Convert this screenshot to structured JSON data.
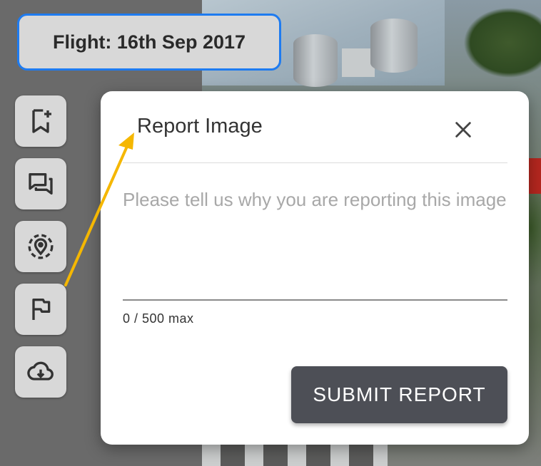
{
  "flight": {
    "label": "Flight: 16th Sep 2017"
  },
  "toolbar": {
    "items": [
      {
        "name": "bookmark-add",
        "icon": "bookmark-plus-icon"
      },
      {
        "name": "comments",
        "icon": "chat-icon"
      },
      {
        "name": "location",
        "icon": "location-pin-icon"
      },
      {
        "name": "report",
        "icon": "flag-icon"
      },
      {
        "name": "download",
        "icon": "cloud-download-icon"
      }
    ]
  },
  "dialog": {
    "title": "Report Image",
    "placeholder": "Please tell us why you are reporting this image",
    "counter": "0 / 500 max",
    "submit_label": "SUBMIT REPORT"
  },
  "colors": {
    "accent_border": "#1e7bf0",
    "annotation_arrow": "#f5b700",
    "submit_bg": "#4d4f56"
  }
}
